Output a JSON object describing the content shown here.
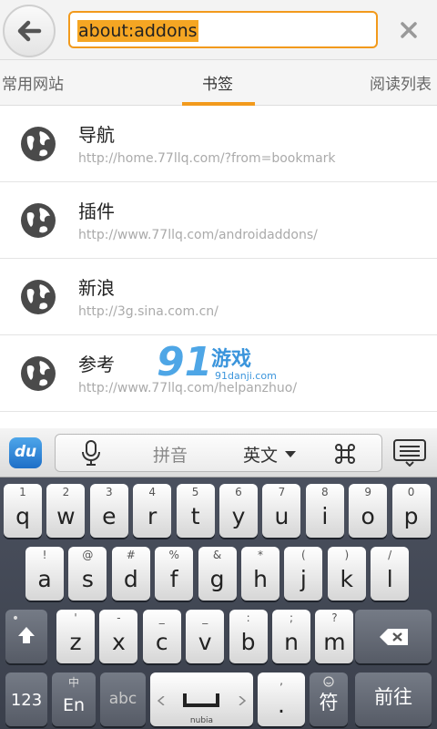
{
  "url_bar": {
    "text": "about:addons"
  },
  "tabs": [
    "常用网站",
    "书签",
    "阅读列表"
  ],
  "bookmarks": [
    {
      "title": "导航",
      "url": "http://home.77llq.com/?from=bookmark"
    },
    {
      "title": "插件",
      "url": "http://www.77llq.com/androidaddons/"
    },
    {
      "title": "新浪",
      "url": "http://3g.sina.com.cn/"
    },
    {
      "title": "参考",
      "url": "http://www.77llq.com/helpanzhuo/"
    }
  ],
  "watermark": {
    "number": "91",
    "text": "游戏",
    "site": "91danji.com"
  },
  "keyboard": {
    "logo": "du",
    "candidates": {
      "pinyin": "拼音",
      "english": "英文"
    },
    "row1": [
      [
        "1",
        "q"
      ],
      [
        "2",
        "w"
      ],
      [
        "3",
        "e"
      ],
      [
        "4",
        "r"
      ],
      [
        "5",
        "t"
      ],
      [
        "6",
        "y"
      ],
      [
        "7",
        "u"
      ],
      [
        "8",
        "i"
      ],
      [
        "9",
        "o"
      ],
      [
        "0",
        "p"
      ]
    ],
    "row2": [
      [
        "!",
        "a"
      ],
      [
        "@",
        "s"
      ],
      [
        "#",
        "d"
      ],
      [
        "%",
        "f"
      ],
      [
        "&",
        "g"
      ],
      [
        "*",
        "h"
      ],
      [
        "(",
        "j"
      ],
      [
        ")",
        "k"
      ],
      [
        "/",
        "l"
      ]
    ],
    "row3": [
      [
        "'",
        "z"
      ],
      [
        "-",
        "x"
      ],
      [
        "_",
        "c"
      ],
      [
        "_",
        "v"
      ],
      [
        ":",
        "b"
      ],
      [
        ";",
        "n"
      ],
      [
        "?",
        "m"
      ]
    ],
    "num_key": "123",
    "lang_top": "中",
    "lang_bottom": "En",
    "abc_key": "abc",
    "space_label": "nubia",
    "period": ".",
    "period_top": ",",
    "fu": "符",
    "enter": "前往"
  },
  "colors": {
    "accent": "#f29a1c",
    "selection": "#f5a623",
    "link": "#aaaaaa"
  }
}
